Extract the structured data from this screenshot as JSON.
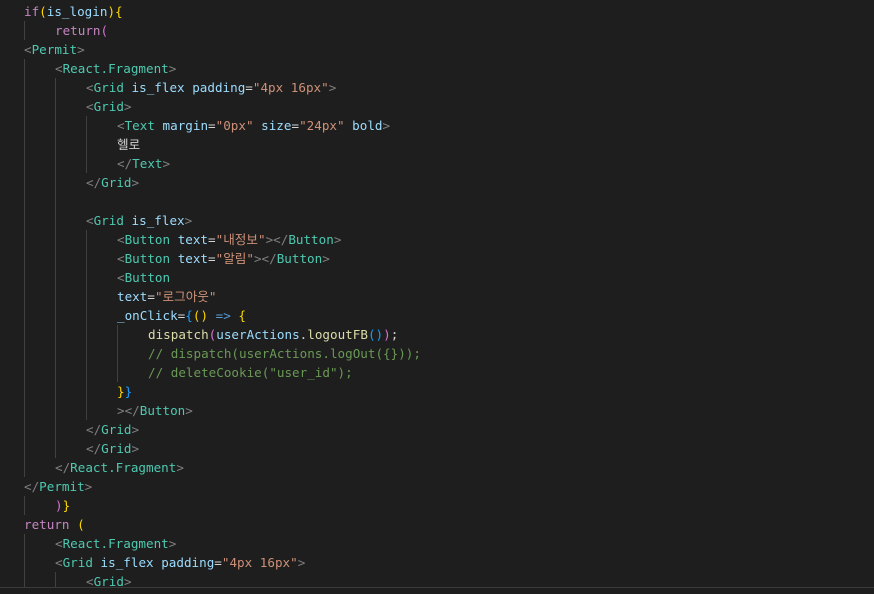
{
  "colors": {
    "background": "#1e1e1e",
    "keyword": "#c586c0",
    "identifier": "#9cdcfe",
    "tag": "#4ec9b0",
    "bracket": "#808080",
    "string": "#ce9178",
    "text": "#d4d4d4",
    "function": "#dcdcaa",
    "comment": "#6a9955",
    "brace_yellow": "#ffd700",
    "brace_purple": "#da70d6",
    "brace_blue": "#179fff",
    "arrow": "#569cd6",
    "guide": "#404040"
  },
  "editor": {
    "lines": [
      {
        "indent": 0,
        "tokens": [
          {
            "t": "if",
            "c": "keyword"
          },
          {
            "t": "(",
            "c": "brace_yellow"
          },
          {
            "t": "is_login",
            "c": "identifier"
          },
          {
            "t": ")",
            "c": "brace_yellow"
          },
          {
            "t": "{",
            "c": "brace_yellow"
          }
        ]
      },
      {
        "indent": 1,
        "tokens": [
          {
            "t": "return",
            "c": "keyword"
          },
          {
            "t": "(",
            "c": "brace_purple"
          }
        ]
      },
      {
        "indent": 0,
        "tokens": [
          {
            "t": "<",
            "c": "bracket"
          },
          {
            "t": "Permit",
            "c": "tag"
          },
          {
            "t": ">",
            "c": "bracket"
          }
        ]
      },
      {
        "indent": 1,
        "tokens": [
          {
            "t": "<",
            "c": "bracket"
          },
          {
            "t": "React.Fragment",
            "c": "tag"
          },
          {
            "t": ">",
            "c": "bracket"
          }
        ]
      },
      {
        "indent": 2,
        "tokens": [
          {
            "t": "<",
            "c": "bracket"
          },
          {
            "t": "Grid",
            "c": "tag"
          },
          {
            "t": " ",
            "c": "text"
          },
          {
            "t": "is_flex",
            "c": "identifier"
          },
          {
            "t": " ",
            "c": "text"
          },
          {
            "t": "padding",
            "c": "identifier"
          },
          {
            "t": "=",
            "c": "text"
          },
          {
            "t": "\"4px 16px\"",
            "c": "string"
          },
          {
            "t": ">",
            "c": "bracket"
          }
        ]
      },
      {
        "indent": 2,
        "tokens": [
          {
            "t": "<",
            "c": "bracket"
          },
          {
            "t": "Grid",
            "c": "tag"
          },
          {
            "t": ">",
            "c": "bracket"
          }
        ]
      },
      {
        "indent": 3,
        "tokens": [
          {
            "t": "<",
            "c": "bracket"
          },
          {
            "t": "Text",
            "c": "tag"
          },
          {
            "t": " ",
            "c": "text"
          },
          {
            "t": "margin",
            "c": "identifier"
          },
          {
            "t": "=",
            "c": "text"
          },
          {
            "t": "\"0px\"",
            "c": "string"
          },
          {
            "t": " ",
            "c": "text"
          },
          {
            "t": "size",
            "c": "identifier"
          },
          {
            "t": "=",
            "c": "text"
          },
          {
            "t": "\"24px\"",
            "c": "string"
          },
          {
            "t": " ",
            "c": "text"
          },
          {
            "t": "bold",
            "c": "identifier"
          },
          {
            "t": ">",
            "c": "bracket"
          }
        ]
      },
      {
        "indent": 3,
        "tokens": [
          {
            "t": "헬로",
            "c": "text"
          }
        ]
      },
      {
        "indent": 3,
        "tokens": [
          {
            "t": "</",
            "c": "bracket"
          },
          {
            "t": "Text",
            "c": "tag"
          },
          {
            "t": ">",
            "c": "bracket"
          }
        ]
      },
      {
        "indent": 2,
        "tokens": [
          {
            "t": "</",
            "c": "bracket"
          },
          {
            "t": "Grid",
            "c": "tag"
          },
          {
            "t": ">",
            "c": "bracket"
          }
        ]
      },
      {
        "indent": 2,
        "tokens": []
      },
      {
        "indent": 2,
        "tokens": [
          {
            "t": "<",
            "c": "bracket"
          },
          {
            "t": "Grid",
            "c": "tag"
          },
          {
            "t": " ",
            "c": "text"
          },
          {
            "t": "is_flex",
            "c": "identifier"
          },
          {
            "t": ">",
            "c": "bracket"
          }
        ]
      },
      {
        "indent": 3,
        "tokens": [
          {
            "t": "<",
            "c": "bracket"
          },
          {
            "t": "Button",
            "c": "tag"
          },
          {
            "t": " ",
            "c": "text"
          },
          {
            "t": "text",
            "c": "identifier"
          },
          {
            "t": "=",
            "c": "text"
          },
          {
            "t": "\"내정보\"",
            "c": "string"
          },
          {
            "t": "></",
            "c": "bracket"
          },
          {
            "t": "Button",
            "c": "tag"
          },
          {
            "t": ">",
            "c": "bracket"
          }
        ]
      },
      {
        "indent": 3,
        "tokens": [
          {
            "t": "<",
            "c": "bracket"
          },
          {
            "t": "Button",
            "c": "tag"
          },
          {
            "t": " ",
            "c": "text"
          },
          {
            "t": "text",
            "c": "identifier"
          },
          {
            "t": "=",
            "c": "text"
          },
          {
            "t": "\"알림\"",
            "c": "string"
          },
          {
            "t": "></",
            "c": "bracket"
          },
          {
            "t": "Button",
            "c": "tag"
          },
          {
            "t": ">",
            "c": "bracket"
          }
        ]
      },
      {
        "indent": 3,
        "tokens": [
          {
            "t": "<",
            "c": "bracket"
          },
          {
            "t": "Button",
            "c": "tag"
          }
        ]
      },
      {
        "indent": 3,
        "tokens": [
          {
            "t": "text",
            "c": "identifier"
          },
          {
            "t": "=",
            "c": "text"
          },
          {
            "t": "\"로그아웃\"",
            "c": "string"
          }
        ]
      },
      {
        "indent": 3,
        "tokens": [
          {
            "t": "_onClick",
            "c": "identifier"
          },
          {
            "t": "=",
            "c": "text"
          },
          {
            "t": "{",
            "c": "brace_blue"
          },
          {
            "t": "()",
            "c": "brace_yellow"
          },
          {
            "t": " ",
            "c": "text"
          },
          {
            "t": "=>",
            "c": "arrow"
          },
          {
            "t": " ",
            "c": "text"
          },
          {
            "t": "{",
            "c": "brace_yellow"
          }
        ]
      },
      {
        "indent": 4,
        "tokens": [
          {
            "t": "dispatch",
            "c": "function"
          },
          {
            "t": "(",
            "c": "brace_purple"
          },
          {
            "t": "userActions",
            "c": "identifier"
          },
          {
            "t": ".",
            "c": "text"
          },
          {
            "t": "logoutFB",
            "c": "function"
          },
          {
            "t": "()",
            "c": "brace_blue"
          },
          {
            "t": ")",
            "c": "brace_purple"
          },
          {
            "t": ";",
            "c": "text"
          }
        ]
      },
      {
        "indent": 4,
        "tokens": [
          {
            "t": "// dispatch(userActions.logOut({}));",
            "c": "comment"
          }
        ]
      },
      {
        "indent": 4,
        "tokens": [
          {
            "t": "// deleteCookie(\"user_id\");",
            "c": "comment"
          }
        ]
      },
      {
        "indent": 3,
        "tokens": [
          {
            "t": "}",
            "c": "brace_yellow"
          },
          {
            "t": "}",
            "c": "brace_blue"
          }
        ]
      },
      {
        "indent": 3,
        "tokens": [
          {
            "t": "></",
            "c": "bracket"
          },
          {
            "t": "Button",
            "c": "tag"
          },
          {
            "t": ">",
            "c": "bracket"
          }
        ]
      },
      {
        "indent": 2,
        "tokens": [
          {
            "t": "</",
            "c": "bracket"
          },
          {
            "t": "Grid",
            "c": "tag"
          },
          {
            "t": ">",
            "c": "bracket"
          }
        ]
      },
      {
        "indent": 2,
        "tokens": [
          {
            "t": "</",
            "c": "bracket"
          },
          {
            "t": "Grid",
            "c": "tag"
          },
          {
            "t": ">",
            "c": "bracket"
          }
        ]
      },
      {
        "indent": 1,
        "tokens": [
          {
            "t": "</",
            "c": "bracket"
          },
          {
            "t": "React.Fragment",
            "c": "tag"
          },
          {
            "t": ">",
            "c": "bracket"
          }
        ]
      },
      {
        "indent": 0,
        "tokens": [
          {
            "t": "</",
            "c": "bracket"
          },
          {
            "t": "Permit",
            "c": "tag"
          },
          {
            "t": ">",
            "c": "bracket"
          }
        ]
      },
      {
        "indent": 1,
        "tokens": [
          {
            "t": ")",
            "c": "brace_purple"
          },
          {
            "t": "}",
            "c": "brace_yellow"
          }
        ]
      },
      {
        "indent": 0,
        "tokens": [
          {
            "t": "return",
            "c": "keyword"
          },
          {
            "t": " ",
            "c": "text"
          },
          {
            "t": "(",
            "c": "brace_yellow"
          }
        ]
      },
      {
        "indent": 1,
        "tokens": [
          {
            "t": "<",
            "c": "bracket"
          },
          {
            "t": "React.Fragment",
            "c": "tag"
          },
          {
            "t": ">",
            "c": "bracket"
          }
        ]
      },
      {
        "indent": 1,
        "tokens": [
          {
            "t": "<",
            "c": "bracket"
          },
          {
            "t": "Grid",
            "c": "tag"
          },
          {
            "t": " ",
            "c": "text"
          },
          {
            "t": "is_flex",
            "c": "identifier"
          },
          {
            "t": " ",
            "c": "text"
          },
          {
            "t": "padding",
            "c": "identifier"
          },
          {
            "t": "=",
            "c": "text"
          },
          {
            "t": "\"4px 16px\"",
            "c": "string"
          },
          {
            "t": ">",
            "c": "bracket"
          }
        ]
      },
      {
        "indent": 2,
        "tokens": [
          {
            "t": "<",
            "c": "bracket"
          },
          {
            "t": "Grid",
            "c": "tag"
          },
          {
            "t": ">",
            "c": "bracket"
          }
        ]
      }
    ]
  }
}
